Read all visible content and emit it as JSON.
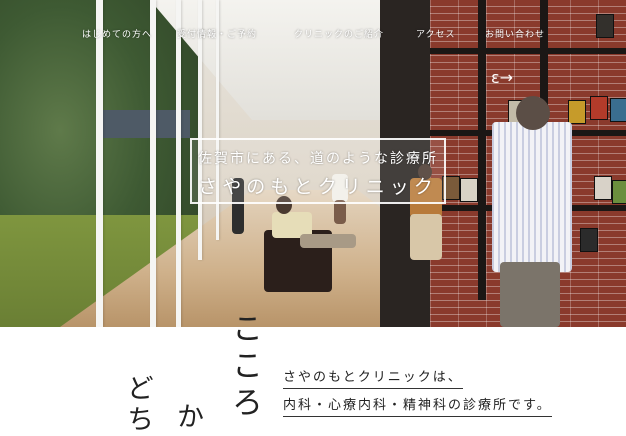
{
  "nav": {
    "items": [
      {
        "label": "はじめての方へ"
      },
      {
        "label": "受付情報・ご予約"
      },
      {
        "label": "クリニックのご紹介"
      },
      {
        "label": "アクセス"
      },
      {
        "label": "お問い合わせ"
      }
    ]
  },
  "hero": {
    "subtitle": "佐賀市にある、道のような診療所",
    "title": "さやのもとクリニック",
    "exit_sign": "ε→"
  },
  "vertical_text": {
    "col1": "こころ",
    "col2": "か",
    "col3": "どち"
  },
  "intro": {
    "line1": "さやのもとクリニックは、",
    "line2": "内科・心療内科・精神科の診療所です。"
  },
  "colors": {
    "accent_text": "#222222",
    "nav_text": "#ffffff"
  }
}
